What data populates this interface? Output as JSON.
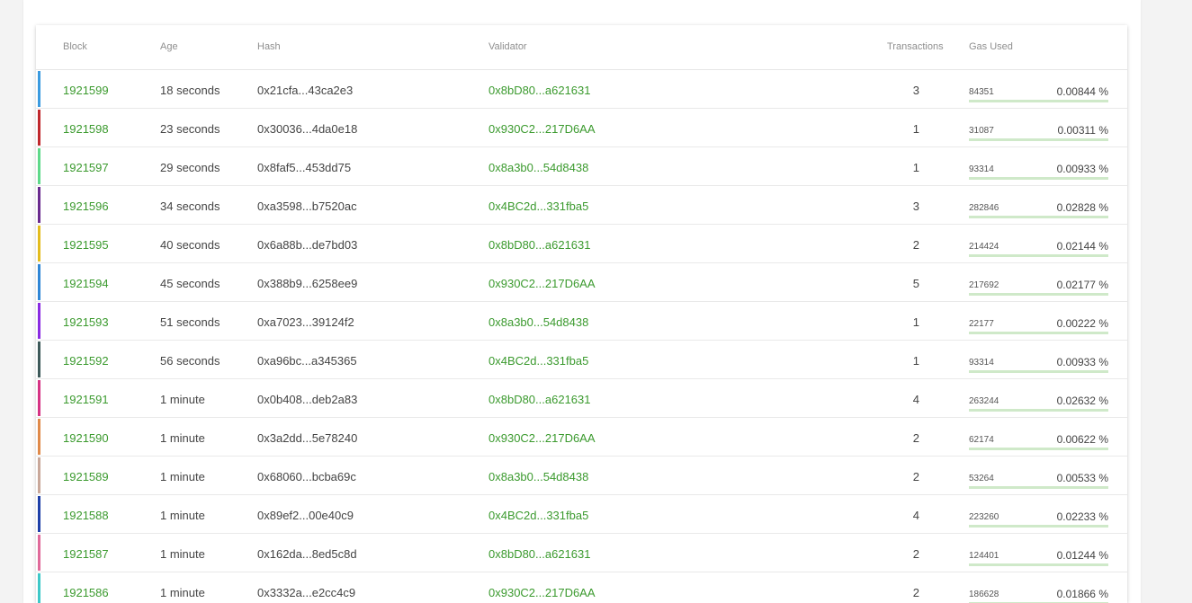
{
  "table": {
    "headers": {
      "block": "Block",
      "age": "Age",
      "hash": "Hash",
      "validator": "Validator",
      "transactions": "Transactions",
      "gas_used": "Gas Used"
    },
    "rows": [
      {
        "block": "1921599",
        "age": "18 seconds",
        "hash": "0x21cfa...43ca2e3",
        "validator": "0x8bD80...a621631",
        "transactions": "3",
        "gas": "84351",
        "gas_pct": "0.00844",
        "color": "#3b9be0"
      },
      {
        "block": "1921598",
        "age": "23 seconds",
        "hash": "0x30036...4da0e18",
        "validator": "0x930C2...217D6AA",
        "transactions": "1",
        "gas": "31087",
        "gas_pct": "0.00311",
        "color": "#c0282d"
      },
      {
        "block": "1921597",
        "age": "29 seconds",
        "hash": "0x8faf5...453dd75",
        "validator": "0x8a3b0...54d8438",
        "transactions": "1",
        "gas": "93314",
        "gas_pct": "0.00933",
        "color": "#5fd98a"
      },
      {
        "block": "1921596",
        "age": "34 seconds",
        "hash": "0xa3598...b7520ac",
        "validator": "0x4BC2d...331fba5",
        "transactions": "3",
        "gas": "282846",
        "gas_pct": "0.02828",
        "color": "#6a2a8e"
      },
      {
        "block": "1921595",
        "age": "40 seconds",
        "hash": "0x6a88b...de7bd03",
        "validator": "0x8bD80...a621631",
        "transactions": "2",
        "gas": "214424",
        "gas_pct": "0.02144",
        "color": "#e3bc1e"
      },
      {
        "block": "1921594",
        "age": "45 seconds",
        "hash": "0x388b9...6258ee9",
        "validator": "0x930C2...217D6AA",
        "transactions": "5",
        "gas": "217692",
        "gas_pct": "0.02177",
        "color": "#2f86d6"
      },
      {
        "block": "1921593",
        "age": "51 seconds",
        "hash": "0xa7023...39124f2",
        "validator": "0x8a3b0...54d8438",
        "transactions": "1",
        "gas": "22177",
        "gas_pct": "0.00222",
        "color": "#8a2be2"
      },
      {
        "block": "1921592",
        "age": "56 seconds",
        "hash": "0xa96bc...a345365",
        "validator": "0x4BC2d...331fba5",
        "transactions": "1",
        "gas": "93314",
        "gas_pct": "0.00933",
        "color": "#3e5a5a"
      },
      {
        "block": "1921591",
        "age": "1 minute",
        "hash": "0x0b408...deb2a83",
        "validator": "0x8bD80...a621631",
        "transactions": "4",
        "gas": "263244",
        "gas_pct": "0.02632",
        "color": "#d63384"
      },
      {
        "block": "1921590",
        "age": "1 minute",
        "hash": "0x3a2dd...5e78240",
        "validator": "0x930C2...217D6AA",
        "transactions": "2",
        "gas": "62174",
        "gas_pct": "0.00622",
        "color": "#e08a4a"
      },
      {
        "block": "1921589",
        "age": "1 minute",
        "hash": "0x68060...bcba69c",
        "validator": "0x8a3b0...54d8438",
        "transactions": "2",
        "gas": "53264",
        "gas_pct": "0.00533",
        "color": "#c9a89a"
      },
      {
        "block": "1921588",
        "age": "1 minute",
        "hash": "0x89ef2...00e40c9",
        "validator": "0x4BC2d...331fba5",
        "transactions": "4",
        "gas": "223260",
        "gas_pct": "0.02233",
        "color": "#1e3fa8"
      },
      {
        "block": "1921587",
        "age": "1 minute",
        "hash": "0x162da...8ed5c8d",
        "validator": "0x8bD80...a621631",
        "transactions": "2",
        "gas": "124401",
        "gas_pct": "0.01244",
        "color": "#e06a9a"
      },
      {
        "block": "1921586",
        "age": "1 minute",
        "hash": "0x3332a...e2cc4c9",
        "validator": "0x930C2...217D6AA",
        "transactions": "2",
        "gas": "186628",
        "gas_pct": "0.01866",
        "color": "#3ec8c8"
      }
    ],
    "pct_symbol": " %"
  },
  "colors": {
    "link": "#3b9a2e",
    "gas_bar_track": "#cfe9c9",
    "gas_bar_fill": "#3b9a2e"
  }
}
